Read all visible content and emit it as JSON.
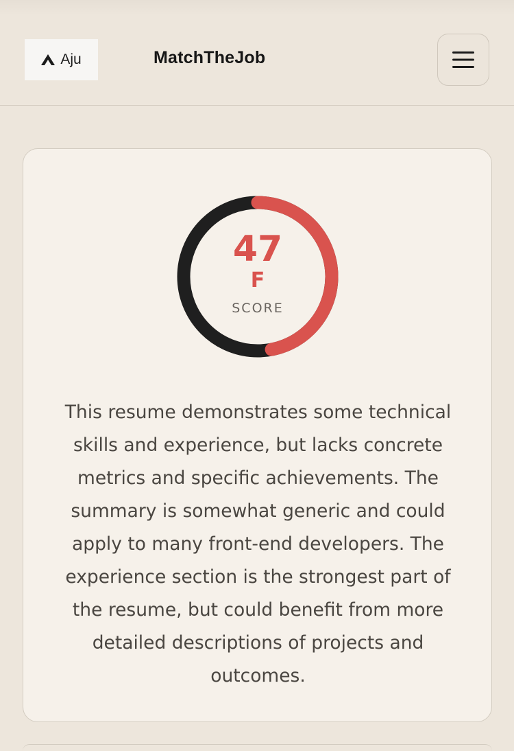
{
  "header": {
    "logo_text": "Aju",
    "app_title": "MatchTheJob",
    "menu_icon": "hamburger-icon"
  },
  "score_card": {
    "score": "47",
    "grade": "F",
    "score_label": "SCORE",
    "score_fraction": 0.47,
    "colors": {
      "accent": "#d9534e",
      "track": "#1f1f1f"
    },
    "summary": "This resume demonstrates some technical skills and experience, but lacks concrete metrics and specific achievements. The summary is somewhat generic and could apply to many front-end developers. The experience section is the strongest part of the resume, but could benefit from more detailed descriptions of projects and outcomes."
  }
}
